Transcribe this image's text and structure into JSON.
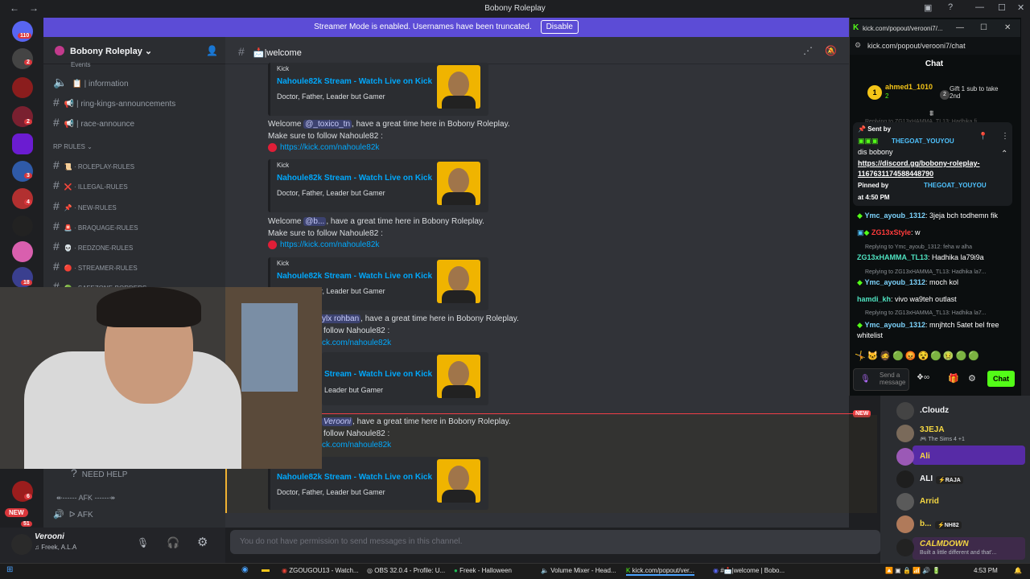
{
  "window": {
    "title": "Bobony Roleplay"
  },
  "banner": {
    "text": "Streamer Mode is enabled. Usernames have been truncated.",
    "disable": "Disable"
  },
  "servers": {
    "badge_top": "110",
    "badge_2": "2",
    "badge_3": "2",
    "badge_4": "3",
    "badge_5": "4",
    "badge_6": "18",
    "badge_7": "6",
    "new": "NEW",
    "badge_8": "51"
  },
  "sidebar": {
    "guild": "Bobony Roleplay",
    "events": "Events",
    "channels": [
      {
        "name": "information",
        "icon": "📋"
      },
      {
        "name": "ring-kings-announcements",
        "icon": "📢"
      },
      {
        "name": "race-announce",
        "icon": "📢"
      }
    ],
    "rp_category": "RP RULES",
    "rules": [
      {
        "name": "ROLEPLAY-RULES",
        "icon": "📜"
      },
      {
        "name": "ILLEGAL-RULES",
        "icon": "❌"
      },
      {
        "name": "NEW-RULES",
        "icon": "📌"
      },
      {
        "name": "BRAQUAGE-RULES",
        "icon": "🚨"
      },
      {
        "name": "REDZONE-RULES",
        "icon": "💀"
      },
      {
        "name": "STREAMER-RULES",
        "icon": "🔴"
      },
      {
        "name": "SAFEZONE-BORDERS",
        "icon": "🟢"
      }
    ],
    "need_help": "NEED HELP",
    "afk_category": "↞------ AFK ------↠",
    "afk_channel": "ᐅ AFK"
  },
  "channel": {
    "name": "welcome",
    "icon": "📩"
  },
  "messages": [
    {
      "text_before": "Welcome ",
      "mention": "@_toxico_tn",
      "text_after": ", have a great time here in Bobony Roleplay.",
      "line2": "Make sure to follow Nahoule82 :",
      "link": "https://kick.com/nahoule82k"
    },
    {
      "text_before": "Welcome ",
      "mention": "@b...",
      "text_after": ", have a great time here in Bobony Roleplay.",
      "line2": "Make sure to follow Nahoule82 :",
      "link": "https://kick.com/nahoule82k"
    },
    {
      "mention": "ylx rohban",
      "text_after": ", have a great time here in Bobony Roleplay.",
      "line2": "follow Nahoule82 :",
      "link": "ck.com/nahoule82k"
    },
    {
      "mention": "Verooni",
      "text_after": ", have a great time here in Bobony Roleplay.",
      "line2": "follow Nahoule82 :",
      "link": "ck.com/nahoule82k"
    }
  ],
  "embed": {
    "provider": "Kick",
    "title": "Nahoule82k Stream - Watch Live on Kick",
    "desc": "Doctor, Father, Leader but Gamer",
    "title_partial": "Stream - Watch Live on Kick",
    "desc_partial": "Leader but Gamer"
  },
  "new_label": "NEW",
  "input": {
    "placeholder": "You do not have permission to send messages in this channel."
  },
  "user": {
    "name": "Verooni",
    "status": "Freek, A.L.A"
  },
  "kick": {
    "tab_title": "kick.com/popout/verooni7/...",
    "url": "kick.com/popout/verooni7/chat",
    "header": "Chat",
    "top_gifter": "ahmed1_1010",
    "top_rank": "1",
    "top_count": "2",
    "gift_count": "2",
    "gift_text": "Gift 1 sub to take 2nd",
    "pinned_sent_by": "Sent by",
    "pinned_user": "THEGOAT_YOUYOU",
    "pinned_msg": "dis bobony",
    "pinned_link": "https://discord.gg/bobony-roleplay-1167631174588448790",
    "pinned_by_label": "Pinned by",
    "pinned_by_user": "THEGOAT_YOUYOU",
    "pinned_time": "at 4:50 PM",
    "behind_reply": "Replying to ZG13xHAMMA_TL13: Hadhika fi",
    "chat": [
      {
        "reply": "",
        "user": "Ymc_ayoub_1312",
        "color": "#7dd3fc",
        "msg": "3jeja bch todhemn fik"
      },
      {
        "reply": "",
        "user": "ZG13xStyle",
        "color": "#ff3b3b",
        "msg": "w"
      },
      {
        "reply": "Replying to Ymc_ayoub_1312: feha w alha",
        "user": "ZG13xHAMMA_TL13",
        "color": "#4fe3c1",
        "msg": "Hadhika la79i9a"
      },
      {
        "reply": "Replying to ZG13xHAMMA_TL13: Hadhika la7...",
        "user": "Ymc_ayoub_1312",
        "color": "#7dd3fc",
        "msg": "moch kol"
      },
      {
        "reply": "",
        "user": "hamdi_kh",
        "color": "#4fe3c1",
        "msg": "vivo wa9teh outlast"
      },
      {
        "reply": "Replying to ZG13xHAMMA_TL13: Hadhika la7...",
        "user": "Ymc_ayoub_1312",
        "color": "#7dd3fc",
        "msg": "mnjhtch 5atet bel free whitelist"
      }
    ],
    "send_placeholder": "Send a message",
    "chat_button": "Chat"
  },
  "members": [
    {
      "name": ".Cloudz",
      "color": "#f2f3f5",
      "sub": ""
    },
    {
      "name": "3JEJA",
      "color": "#f5d742",
      "sub": "🎮 The Sims 4 +1"
    },
    {
      "name": "Ali",
      "color": "#f5d742",
      "sub": ""
    },
    {
      "name": "ALI",
      "color": "#f2f3f5",
      "sub": "",
      "tag": "⚡RAJA"
    },
    {
      "name": "Arrid",
      "color": "#f5d742",
      "sub": ""
    },
    {
      "name": "b...",
      "color": "#f5d742",
      "sub": "",
      "tag": "⚡NH82"
    },
    {
      "name": "CALMDOWN",
      "color": "#f5d742",
      "sub": "Built a little different and that'..."
    }
  ],
  "taskbar": {
    "items": [
      "ZGOUGOU13 - Watch...",
      "OBS 32.0.4 - Profile: U...",
      "Freek - Halloween",
      "Volume Mixer - Head...",
      "kick.com/popout/ver...",
      "#📩|welcome | Bobo..."
    ],
    "time": "4:53 PM"
  },
  "colors": {
    "blurple": "#5c4cd6",
    "kick_green": "#53fc18",
    "link": "#00a8fc"
  }
}
